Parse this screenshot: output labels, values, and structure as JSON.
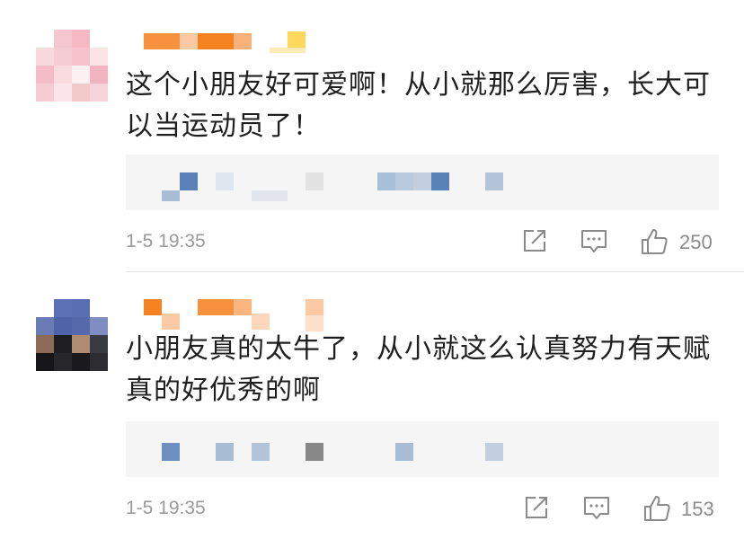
{
  "colors": {
    "text": "#1f1f1f",
    "meta": "#9a9a9a",
    "icon": "#8a8a8a",
    "reply_bg": "#f5f5f5",
    "divider": "#e8e8e8"
  },
  "comments": [
    {
      "text": "这个小朋友好可爱啊！从小就那么厉害，长大可以当运动员了！",
      "timestamp": "1-5 19:35",
      "likes": "250",
      "icons": [
        "share-icon",
        "comment-icon",
        "like-icon"
      ]
    },
    {
      "text": "小朋友真的太牛了，从小就这么认真努力有天赋真的好优秀的啊",
      "timestamp": "1-5 19:35",
      "likes": "153",
      "icons": [
        "share-icon",
        "comment-icon",
        "like-icon"
      ]
    }
  ]
}
